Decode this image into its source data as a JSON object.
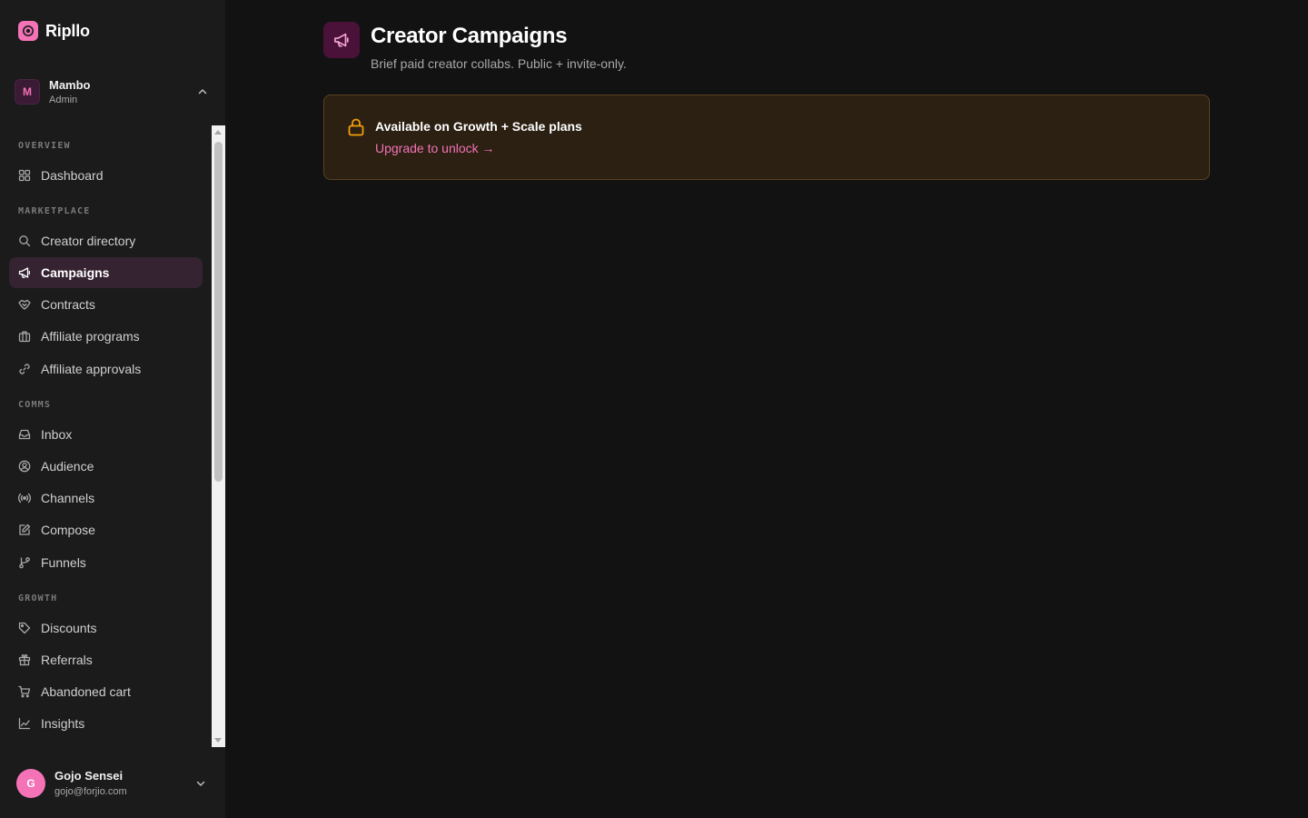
{
  "colors": {
    "accent": "#f472b6",
    "sidebar_bg": "#1b1b1b",
    "main_bg": "#121212",
    "active_item_bg": "#352331",
    "warning": "#f59e0b",
    "lock_card_bg": "#2b2012"
  },
  "brand": {
    "name": "Ripllo",
    "icon": "brand-logo-icon"
  },
  "workspace": {
    "initial": "M",
    "name": "Mambo",
    "role": "Admin",
    "icon": "chevron-up-icon"
  },
  "sidebar": {
    "sections": [
      {
        "label": "OVERVIEW"
      },
      {
        "label": "MARKETPLACE"
      },
      {
        "label": "COMMS"
      },
      {
        "label": "GROWTH"
      }
    ],
    "items": [
      {
        "label": "Dashboard",
        "icon": "grid-icon"
      },
      {
        "label": "Creator directory",
        "icon": "search-icon"
      },
      {
        "label": "Campaigns",
        "icon": "megaphone-icon",
        "active": true
      },
      {
        "label": "Contracts",
        "icon": "handshake-icon"
      },
      {
        "label": "Affiliate programs",
        "icon": "briefcase-icon"
      },
      {
        "label": "Affiliate approvals",
        "icon": "link-icon"
      },
      {
        "label": "Inbox",
        "icon": "inbox-icon"
      },
      {
        "label": "Audience",
        "icon": "user-circle-icon"
      },
      {
        "label": "Channels",
        "icon": "broadcast-icon"
      },
      {
        "label": "Compose",
        "icon": "edit-icon"
      },
      {
        "label": "Funnels",
        "icon": "git-branch-icon"
      },
      {
        "label": "Discounts",
        "icon": "tag-icon"
      },
      {
        "label": "Referrals",
        "icon": "gift-icon"
      },
      {
        "label": "Abandoned cart",
        "icon": "cart-icon"
      },
      {
        "label": "Insights",
        "icon": "line-chart-icon"
      }
    ]
  },
  "user": {
    "initial": "G",
    "name": "Gojo Sensei",
    "email": "gojo@forjio.com",
    "icon": "chevron-down-icon"
  },
  "page": {
    "icon": "megaphone-icon",
    "title": "Creator Campaigns",
    "subtitle": "Brief paid creator collabs. Public + invite-only."
  },
  "lock_notice": {
    "icon": "lock-icon",
    "title": "Available on Growth + Scale plans",
    "link": "Upgrade to unlock →"
  }
}
